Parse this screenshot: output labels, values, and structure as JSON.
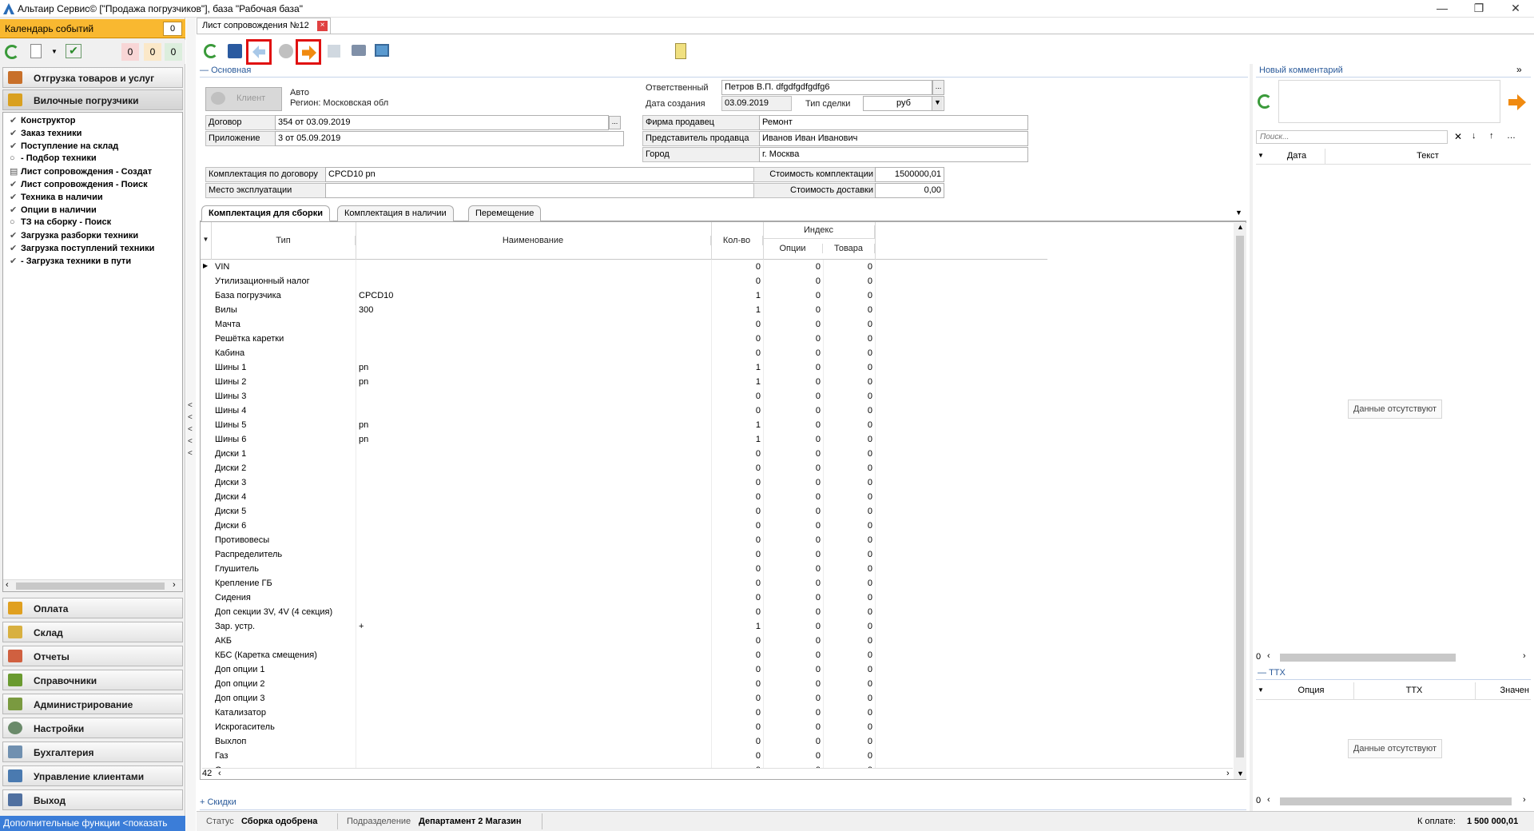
{
  "window": {
    "title": "Альтаир Сервис© [\"Продажа погрузчиков\"], база \"Рабочая база\""
  },
  "calendar": {
    "label": "Календарь событий",
    "count": "0",
    "counters": [
      "0",
      "0",
      "0"
    ]
  },
  "nav_top": [
    {
      "label": "Отгрузка товаров и услуг"
    },
    {
      "label": "Вилочные погрузчики"
    }
  ],
  "tree": [
    {
      "label": "Конструктор",
      "mark": "✔"
    },
    {
      "label": "Заказ техники",
      "mark": "✔"
    },
    {
      "label": "Поступление на склад",
      "mark": "✔"
    },
    {
      "label": "- Подбор техники",
      "mark": "○"
    },
    {
      "label": "Лист сопровождения - Создат",
      "mark": "▤"
    },
    {
      "label": "Лист сопровождения - Поиск",
      "mark": "✔"
    },
    {
      "label": "Техника в наличии",
      "mark": "✔"
    },
    {
      "label": "Опции в наличии",
      "mark": "✔"
    },
    {
      "label": "ТЗ на сборку - Поиск",
      "mark": "○"
    },
    {
      "label": "Загрузка разборки техники",
      "mark": "✔"
    },
    {
      "label": "Загрузка поступлений техники",
      "mark": "✔"
    },
    {
      "label": "- Загрузка техники в пути",
      "mark": "✔"
    }
  ],
  "nav_bottom": [
    {
      "label": "Оплата"
    },
    {
      "label": "Склад"
    },
    {
      "label": "Отчеты"
    },
    {
      "label": "Справочники"
    },
    {
      "label": "Администрирование"
    },
    {
      "label": "Настройки"
    },
    {
      "label": "Бухгалтерия"
    },
    {
      "label": "Управление клиентами"
    },
    {
      "label": "Выход"
    }
  ],
  "extra_functions": "Дополнительные функции <показать",
  "doc_tab": {
    "title": "Лист сопровождения №12",
    "close": "×"
  },
  "section_main": "Основная",
  "client": {
    "button": "Клиент",
    "line1": "Авто",
    "line2": "Регион: Московская обл"
  },
  "fields": {
    "responsible_label": "Ответственный",
    "responsible_value": "Петров В.П. dfgdfgdfgdfg6",
    "created_label": "Дата создания",
    "created_value": "03.09.2019",
    "deal_type_label": "Тип сделки",
    "deal_type_value": "руб",
    "contract_label": "Договор",
    "contract_value": "354 от 03.09.2019",
    "appendix_label": "Приложение",
    "appendix_value": "3 от 05.09.2019",
    "seller_label": "Фирма продавец",
    "seller_value": "Ремонт",
    "seller_rep_label": "Представитель продавца",
    "seller_rep_value": "Иванов Иван Иванович",
    "city_label": "Город",
    "city_value": "г. Москва",
    "kit_label": "Комплектация по договору",
    "kit_value": "CPCD10 pn",
    "place_label": "Место эксплуатации",
    "place_value": "",
    "kit_cost_label": "Стоимость комплектации",
    "kit_cost_value": "1500000,01",
    "delivery_cost_label": "Стоимость доставки",
    "delivery_cost_value": "0,00"
  },
  "tabs": [
    "Комплектация для сборки",
    "Комплектация в наличии",
    "Перемещение"
  ],
  "grid": {
    "headers": {
      "type": "Тип",
      "name": "Наименование",
      "qty": "Кол-во",
      "index": "Индекс",
      "options": "Опции",
      "goods": "Товара"
    },
    "rows": [
      [
        "VIN",
        "",
        "0",
        "0",
        "0"
      ],
      [
        "Утилизационный налог",
        "",
        "0",
        "0",
        "0"
      ],
      [
        "База погрузчика",
        "CPCD10",
        "1",
        "0",
        "0"
      ],
      [
        "Вилы",
        "300",
        "1",
        "0",
        "0"
      ],
      [
        "Мачта",
        "",
        "0",
        "0",
        "0"
      ],
      [
        "Решётка каретки",
        "",
        "0",
        "0",
        "0"
      ],
      [
        "Кабина",
        "",
        "0",
        "0",
        "0"
      ],
      [
        "Шины 1",
        "pn",
        "1",
        "0",
        "0"
      ],
      [
        "Шины 2",
        "pn",
        "1",
        "0",
        "0"
      ],
      [
        "Шины 3",
        "",
        "0",
        "0",
        "0"
      ],
      [
        "Шины 4",
        "",
        "0",
        "0",
        "0"
      ],
      [
        "Шины 5",
        "pn",
        "1",
        "0",
        "0"
      ],
      [
        "Шины 6",
        "pn",
        "1",
        "0",
        "0"
      ],
      [
        "Диски 1",
        "",
        "0",
        "0",
        "0"
      ],
      [
        "Диски 2",
        "",
        "0",
        "0",
        "0"
      ],
      [
        "Диски 3",
        "",
        "0",
        "0",
        "0"
      ],
      [
        "Диски 4",
        "",
        "0",
        "0",
        "0"
      ],
      [
        "Диски 5",
        "",
        "0",
        "0",
        "0"
      ],
      [
        "Диски 6",
        "",
        "0",
        "0",
        "0"
      ],
      [
        "Противовесы",
        "",
        "0",
        "0",
        "0"
      ],
      [
        "Распределитель",
        "",
        "0",
        "0",
        "0"
      ],
      [
        "Глушитель",
        "",
        "0",
        "0",
        "0"
      ],
      [
        "Крепление ГБ",
        "",
        "0",
        "0",
        "0"
      ],
      [
        "Сидения",
        "",
        "0",
        "0",
        "0"
      ],
      [
        "Доп секции 3V, 4V (4 секция)",
        "",
        "0",
        "0",
        "0"
      ],
      [
        "Зар. устр.",
        "+",
        "1",
        "0",
        "0"
      ],
      [
        "АКБ",
        "",
        "0",
        "0",
        "0"
      ],
      [
        "КБС (Каретка смещения)",
        "",
        "0",
        "0",
        "0"
      ],
      [
        "Доп опции 1",
        "",
        "0",
        "0",
        "0"
      ],
      [
        "Доп опции 2",
        "",
        "0",
        "0",
        "0"
      ],
      [
        "Доп опции 3",
        "",
        "0",
        "0",
        "0"
      ],
      [
        "Катализатор",
        "",
        "0",
        "0",
        "0"
      ],
      [
        "Искрогаситель",
        "",
        "0",
        "0",
        "0"
      ],
      [
        "Выхлоп",
        "",
        "0",
        "0",
        "0"
      ],
      [
        "Газ",
        "",
        "0",
        "0",
        "0"
      ],
      [
        "Ограждение водителя",
        "",
        "0",
        "0",
        "0"
      ]
    ],
    "row_count": "42"
  },
  "section_discounts": "Скидки",
  "status": {
    "status_label": "Статус",
    "status_value": "Сборка одобрена",
    "dept_label": "Подразделение",
    "dept_value": "Департамент 2 Магазин",
    "pay_label": "К оплате:",
    "pay_value": "1 500 000,01"
  },
  "right": {
    "new_comment": "Новый комментарий",
    "search_placeholder": "Поиск...",
    "col_date": "Дата",
    "col_text": "Текст",
    "no_data": "Данные отсутствуют",
    "count": "0",
    "ttx": "ТТХ",
    "col_option": "Опция",
    "col_ttx": "ТТХ",
    "col_value": "Значен",
    "no_data2": "Данные отсутствуют",
    "count2": "0"
  }
}
